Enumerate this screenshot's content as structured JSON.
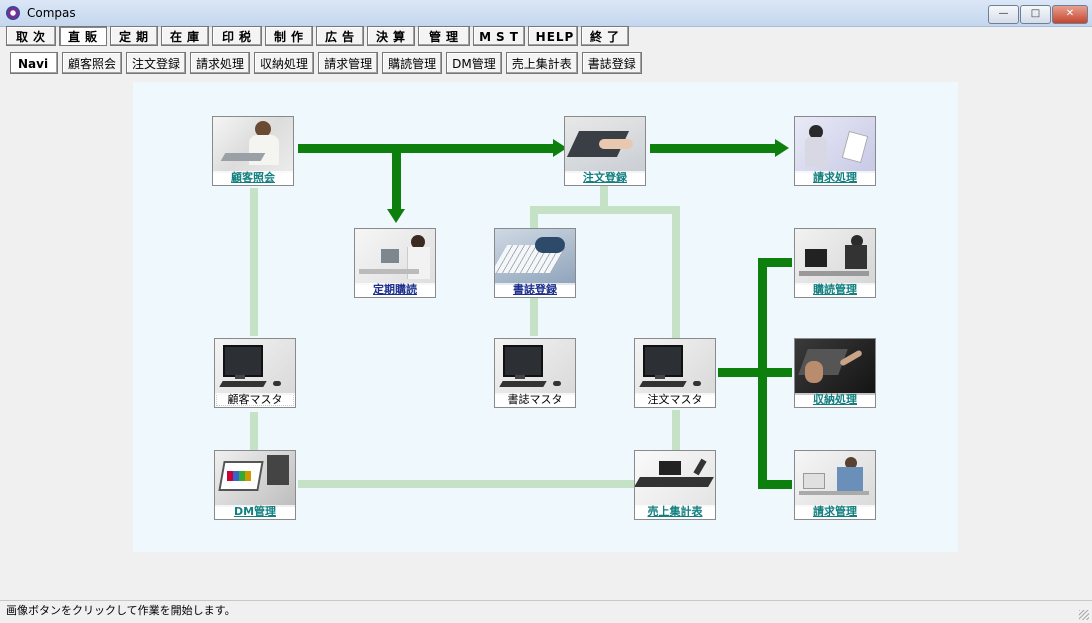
{
  "window": {
    "title": "Compas",
    "minimize": "—",
    "maximize": "□",
    "close": "✕"
  },
  "menu": [
    {
      "label": "取次"
    },
    {
      "label": "直販"
    },
    {
      "label": "定期"
    },
    {
      "label": "在庫"
    },
    {
      "label": "印税"
    },
    {
      "label": "制作"
    },
    {
      "label": "広告"
    },
    {
      "label": "決算"
    },
    {
      "label": "管理"
    },
    {
      "label": "MST"
    },
    {
      "label": "HELP"
    },
    {
      "label": "終了"
    }
  ],
  "submenu": [
    {
      "label": "Navi"
    },
    {
      "label": "顧客照会"
    },
    {
      "label": "注文登録"
    },
    {
      "label": "請求処理"
    },
    {
      "label": "収納処理"
    },
    {
      "label": "請求管理"
    },
    {
      "label": "購読管理"
    },
    {
      "label": "DM管理"
    },
    {
      "label": "売上集計表"
    },
    {
      "label": "書誌登録"
    }
  ],
  "nav": {
    "customer_inquiry": {
      "label": "顧客照会",
      "icon": "woman-on-phone-icon"
    },
    "order_entry": {
      "label": "注文登録",
      "icon": "typing-hands-icon"
    },
    "billing_process": {
      "label": "請求処理",
      "icon": "woman-with-documents-icon"
    },
    "subscription": {
      "label": "定期購読",
      "icon": "woman-at-desk-icon"
    },
    "book_entry": {
      "label": "書誌登録",
      "icon": "keyboard-typing-icon"
    },
    "reading_mgmt": {
      "label": "購読管理",
      "icon": "man-at-computer-icon"
    },
    "customer_master": {
      "label": "顧客マスタ",
      "icon": "desktop-computer-icon"
    },
    "book_master": {
      "label": "書誌マスタ",
      "icon": "desktop-computer-icon"
    },
    "order_master": {
      "label": "注文マスタ",
      "icon": "desktop-computer-icon"
    },
    "payment_process": {
      "label": "収納処理",
      "icon": "writing-hand-icon"
    },
    "dm_mgmt": {
      "label": "DM管理",
      "icon": "chart-laptop-icon"
    },
    "sales_summary": {
      "label": "売上集計表",
      "icon": "laptop-on-table-icon"
    },
    "billing_mgmt": {
      "label": "請求管理",
      "icon": "man-on-phone-icon"
    }
  },
  "status": {
    "message": "画像ボタンをクリックして作業を開始します。"
  }
}
